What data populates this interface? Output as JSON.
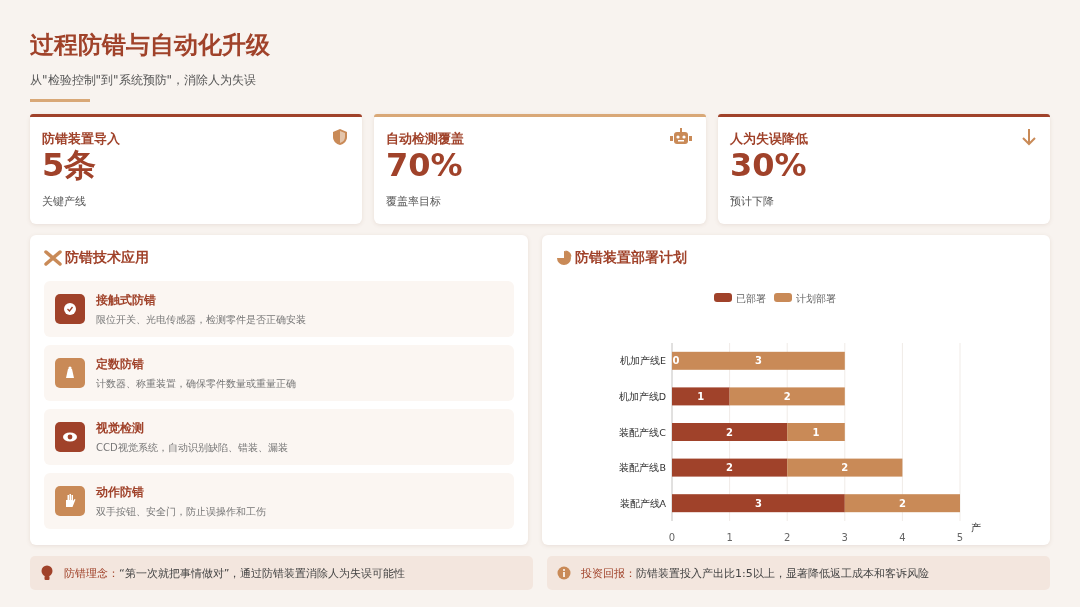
{
  "header": {
    "title": "过程防错与自动化升级",
    "subtitle": "从\"检验控制\"到\"系统预防\"，消除人为失误"
  },
  "stats": [
    {
      "label": "防错装置导入",
      "value": "5条",
      "note": "关键产线",
      "color": "#a0422a"
    },
    {
      "label": "自动检测覆盖",
      "value": "70%",
      "note": "覆盖率目标",
      "color": "#d9a877"
    },
    {
      "label": "人为失误降低",
      "value": "30%",
      "note": "预计下降",
      "color": "#a0422a"
    }
  ],
  "techniques": {
    "title": "防错技术应用",
    "items": [
      {
        "kind": "check",
        "color": "#a0422a",
        "name": "接触式防错",
        "desc": "限位开关、光电传感器，检测零件是否正确安装"
      },
      {
        "kind": "weight",
        "color": "#c98a57",
        "name": "定数防错",
        "desc": "计数器、称重装置，确保零件数量或重量正确"
      },
      {
        "kind": "eye",
        "color": "#a0422a",
        "name": "视觉检测",
        "desc": "CCD视觉系统，自动识别缺陷、错装、漏装"
      },
      {
        "kind": "hand",
        "color": "#c98a57",
        "name": "动作防错",
        "desc": "双手按钮、安全门，防止误操作和工伤"
      }
    ]
  },
  "deployment": {
    "title": "防错装置部署计划",
    "chart_data": {
      "type": "bar",
      "orientation": "horizontal",
      "stacked": true,
      "value_labels": [
        [
          "0",
          "1",
          "2",
          "2",
          "3"
        ],
        [
          "3",
          "2",
          "1",
          "2",
          "2"
        ]
      ],
      "grid": true,
      "legend": "top",
      "xlabel": "产",
      "categories": [
        "机加产线E",
        "机加产线D",
        "装配产线C",
        "装配产线B",
        "装配产线A"
      ],
      "series": [
        {
          "name": "已部署",
          "color": "#a0422a",
          "values": [
            0,
            1,
            2,
            2,
            3
          ]
        },
        {
          "name": "计划部署",
          "color": "#c98a57",
          "values": [
            3,
            2,
            1,
            2,
            2
          ]
        }
      ],
      "xlim": [
        0,
        5
      ],
      "xticks": [
        0,
        1,
        2,
        3,
        4,
        5
      ]
    }
  },
  "notes": [
    {
      "kind": "bulb",
      "text": "**防错理念：**“第一次就把事情做对”，通过防错装置消除人为失误可能性"
    },
    {
      "kind": "info",
      "text": "**投资回报：**防错装置投入产出比1:5以上，显著降低返工成本和客诉风险"
    }
  ]
}
